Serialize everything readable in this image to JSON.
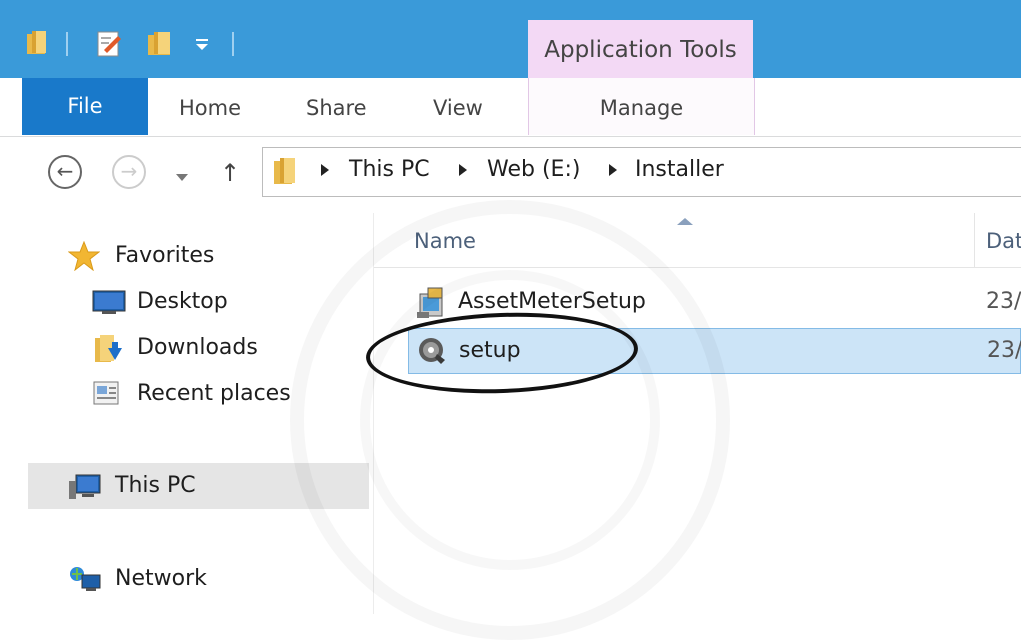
{
  "titlebar": {
    "contextual_tab_label": "Application Tools"
  },
  "ribbon": {
    "tabs": [
      "File",
      "Home",
      "Share",
      "View"
    ],
    "contextual_tab": "Manage"
  },
  "address": {
    "crumbs": [
      "This PC",
      "Web (E:)",
      "Installer"
    ]
  },
  "nav_pane": {
    "favorites_label": "Favorites",
    "favorites_items": [
      "Desktop",
      "Downloads",
      "Recent places"
    ],
    "this_pc_label": "This PC",
    "network_label": "Network"
  },
  "file_list": {
    "columns": [
      "Name",
      "Dat"
    ],
    "rows": [
      {
        "name": "AssetMeterSetup",
        "date": "23/",
        "icon": "installer-package-icon"
      },
      {
        "name": "setup",
        "date": "23/",
        "icon": "setup-disc-icon"
      }
    ]
  },
  "colors": {
    "titlebar": "#3a9ad9",
    "file_tab": "#1979ca",
    "contextual": "#f3d9f5",
    "selection": "#cce4f7",
    "selection_border": "#84bbe6"
  }
}
